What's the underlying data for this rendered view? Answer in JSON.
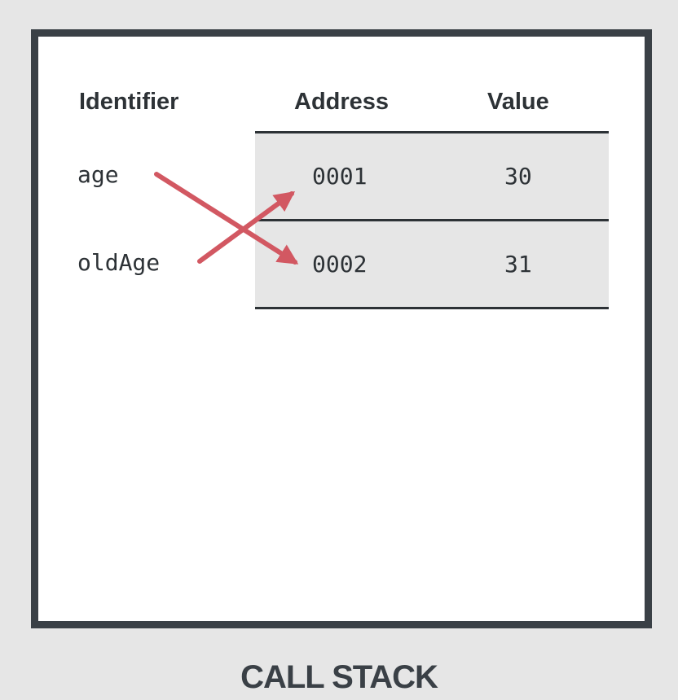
{
  "headers": {
    "identifier": "Identifier",
    "address": "Address",
    "value": "Value"
  },
  "identifiers": [
    "age",
    "oldAge"
  ],
  "memory_rows": [
    {
      "address": "0001",
      "value": "30"
    },
    {
      "address": "0002",
      "value": "31"
    }
  ],
  "pointers": [
    {
      "identifier": "age",
      "points_to_address": "0002"
    },
    {
      "identifier": "oldAge",
      "points_to_address": "0001"
    }
  ],
  "footer": {
    "title": "CALL STACK"
  },
  "colors": {
    "background": "#e6e6e6",
    "frame": "#3a4046",
    "arrow": "#d25862",
    "row_fill": "#e6e6e6",
    "text": "#2d3236"
  }
}
